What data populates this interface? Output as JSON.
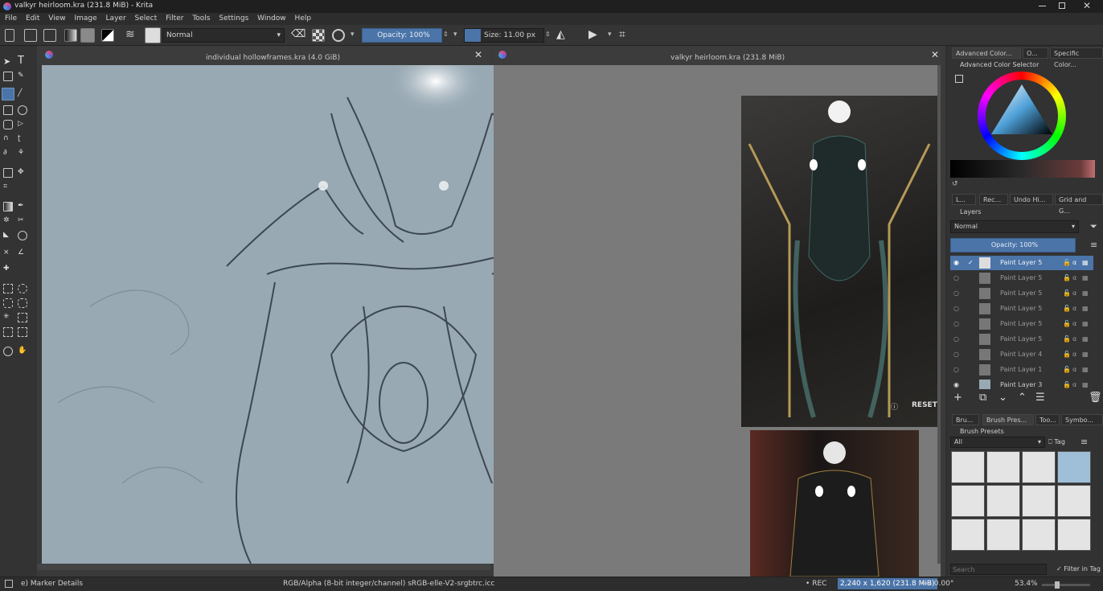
{
  "app": {
    "title": "valkyr heirloom.kra (231.8 MiB)  - Krita"
  },
  "menubar": [
    "File",
    "Edit",
    "View",
    "Image",
    "Layer",
    "Select",
    "Filter",
    "Tools",
    "Settings",
    "Window",
    "Help"
  ],
  "toolbar": {
    "blend_mode": "Normal",
    "opacity": "Opacity: 100%",
    "size": "Size: 11.00 px"
  },
  "documents": [
    {
      "title": "individual hollowframes.kra (4.0 GiB)"
    },
    {
      "title": "valkyr heirloom.kra (231.8 MiB)"
    }
  ],
  "reference_images": [
    {
      "label": "RESET D"
    }
  ],
  "dockers": {
    "top_tabs": [
      "Advanced Color...",
      "O...",
      "Specific Color..."
    ],
    "color_selector_title": "Advanced Color Selector",
    "mid_tabs": [
      "L...",
      "Rec...",
      "Undo Hi...",
      "Grid and G..."
    ],
    "layers": {
      "title": "Layers",
      "blend_mode": "Normal",
      "opacity": "Opacity:  100%",
      "items": [
        {
          "name": "Paint Layer 5"
        },
        {
          "name": "Paint Layer 5"
        },
        {
          "name": "Paint Layer 5"
        },
        {
          "name": "Paint Layer 5"
        },
        {
          "name": "Paint Layer 5"
        },
        {
          "name": "Paint Layer 5"
        },
        {
          "name": "Paint Layer 4"
        },
        {
          "name": "Paint Layer 1"
        },
        {
          "name": "Paint Layer 3"
        }
      ]
    },
    "bottom_tabs": [
      "Bru...",
      "Brush Pres...",
      "Too...",
      "Symbo..."
    ],
    "brush_presets": {
      "title": "Brush Presets",
      "filter": "All",
      "tag": "Tag",
      "search_placeholder": "Search",
      "filter_in_tag": "Filter in Tag"
    }
  },
  "statusbar": {
    "tool": "e) Marker Details",
    "color_profile": "RGB/Alpha (8-bit integer/channel)  sRGB-elle-V2-srgbtrc.icc",
    "rec": "REC",
    "dimensions": "2,240 x 1,620 (231.8 MiB)",
    "rotation": "0.00°",
    "zoom": "53.4%"
  }
}
